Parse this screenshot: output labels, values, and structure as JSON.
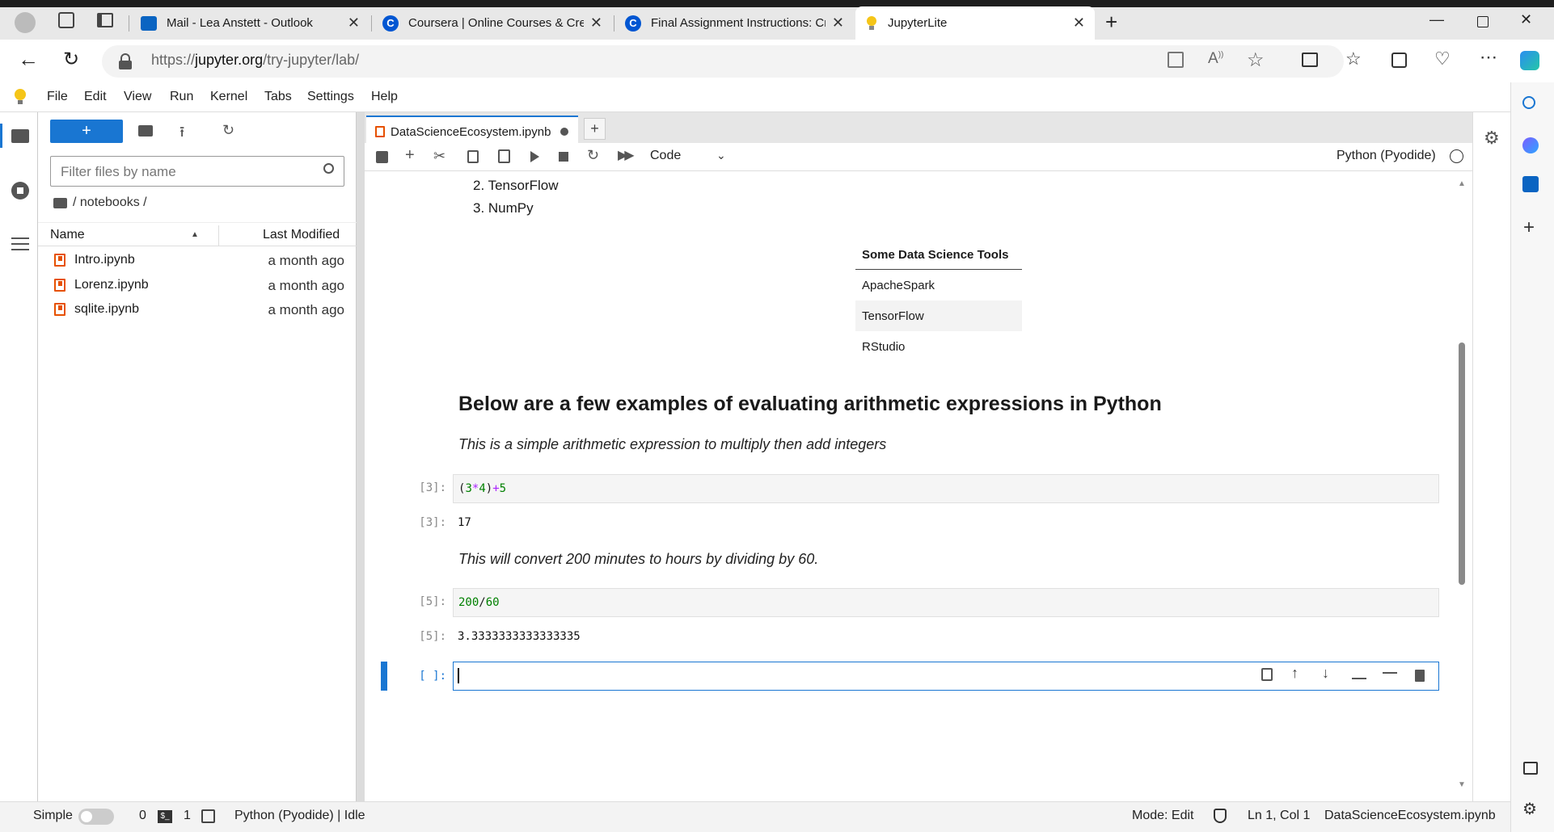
{
  "browser": {
    "tabs": [
      {
        "title": "Mail - Lea Anstett - Outlook",
        "icon": "outlook-icon"
      },
      {
        "title": "Coursera | Online Courses & Cre",
        "icon": "coursera-icon"
      },
      {
        "title": "Final Assignment Instructions: Cr",
        "icon": "coursera-icon"
      },
      {
        "title": "JupyterLite",
        "icon": "jupyter-icon",
        "active": true
      }
    ],
    "url_prefix": "https://",
    "url_host": "jupyter.org",
    "url_path": "/try-jupyter/lab/"
  },
  "menu": [
    "File",
    "Edit",
    "View",
    "Run",
    "Kernel",
    "Tabs",
    "Settings",
    "Help"
  ],
  "filebrowser": {
    "new_label": "+",
    "filter_placeholder": "Filter files by name",
    "breadcrumb": "/ notebooks /",
    "col_name": "Name",
    "col_modified": "Last Modified",
    "files": [
      {
        "name": "Intro.ipynb",
        "modified": "a month ago"
      },
      {
        "name": "Lorenz.ipynb",
        "modified": "a month ago"
      },
      {
        "name": "sqlite.ipynb",
        "modified": "a month ago"
      }
    ]
  },
  "notebook": {
    "tab_title": "DataScienceEcosystem.ipynb",
    "cell_type": "Code",
    "kernel": "Python (Pyodide)",
    "list_items": [
      "2. TensorFlow",
      "3. NumPy"
    ],
    "table": {
      "header": "Some Data Science Tools",
      "rows": [
        "ApacheSpark",
        "TensorFlow",
        "RStudio"
      ]
    },
    "heading": "Below are a few examples of evaluating arithmetic expressions in Python",
    "md1": "This is a simple arithmetic expression to multiply then add integers",
    "cell3_prompt_in": "[3]:",
    "cell3_code": {
      "p1": "(",
      "n1": "3",
      "op1": "*",
      "n2": "4",
      "p2": ")",
      "op2": "+",
      "n3": "5"
    },
    "cell3_prompt_out": "[3]:",
    "cell3_output": "17",
    "md2": "This will convert 200 minutes to hours by dividing by 60.",
    "cell5_prompt_in": "[5]:",
    "cell5_code": {
      "n1": "200",
      "op": "/",
      "n2": "60"
    },
    "cell5_prompt_out": "[5]:",
    "cell5_output": "3.3333333333333335",
    "active_prompt": "[ ]:"
  },
  "status": {
    "mode_label": "Simple",
    "terminals": "0",
    "kernels": "1",
    "kernel_status": "Python (Pyodide) | Idle",
    "edit_mode": "Mode: Edit",
    "cursor": "Ln 1, Col 1",
    "filename": "DataScienceEcosystem.ipynb"
  },
  "colors": {
    "accent": "#1976d2",
    "notebook_icon": "#e65100"
  }
}
